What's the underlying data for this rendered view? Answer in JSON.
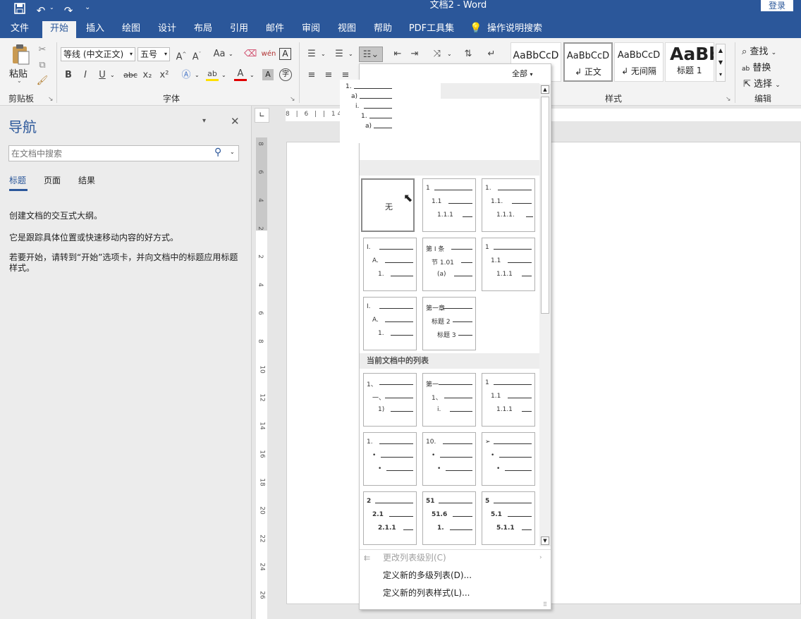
{
  "window": {
    "title": "文档2  -  Word",
    "login": "登录"
  },
  "qat": {
    "save": "save-icon",
    "undo": "undo-icon",
    "redo": "redo-icon"
  },
  "tabs": [
    "文件",
    "开始",
    "插入",
    "绘图",
    "设计",
    "布局",
    "引用",
    "邮件",
    "审阅",
    "视图",
    "帮助",
    "PDF工具集"
  ],
  "search_hint": "操作说明搜索",
  "clipboard": {
    "paste": "粘贴",
    "group": "剪贴板"
  },
  "font": {
    "name": "等线 (中文正文)",
    "size": "五号",
    "group": "字体",
    "case": "Aa",
    "pinyin": "wén",
    "bold": "B",
    "italic": "I",
    "underline": "U",
    "strike": "abc",
    "sub": "x₂",
    "sup": "x²",
    "color_a": "A",
    "shade_a": "A",
    "char_a": "A",
    "enclose": "字"
  },
  "styles": {
    "group": "样式",
    "items": [
      {
        "preview": "AaBbCcD",
        "name": ""
      },
      {
        "preview": "AaBbCcD",
        "name": "↲ 正文"
      },
      {
        "preview": "AaBbCcD",
        "name": "↲ 无间隔"
      },
      {
        "preview": "AaBb",
        "name": "标题 1"
      }
    ]
  },
  "editing": {
    "group": "编辑",
    "find": "查找",
    "replace": "替换",
    "select": "选择"
  },
  "nav": {
    "title": "导航",
    "search_placeholder": "在文档中搜索",
    "tabs": [
      "标题",
      "页面",
      "结果"
    ],
    "p1": "创建文档的交互式大纲。",
    "p2": "它是跟踪具体位置或快速移动内容的好方式。",
    "p3": "若要开始，请转到“开始”选项卡，并向文档中的标题应用标题样式。"
  },
  "ruler": {
    "h": "8 | 6 |        | 14 | 16 | 18 | 20 | 22 | 24 | 26 | 28 | 30",
    "v": [
      "8",
      "6",
      "4",
      "2",
      "2",
      "4",
      "6",
      "8",
      "10",
      "12",
      "14",
      "16",
      "18",
      "20",
      "22",
      "24",
      "26"
    ]
  },
  "gallery": {
    "filter": "全部",
    "preview": [
      "1.",
      "a)",
      "i.",
      "1.",
      "a)"
    ],
    "none_label": "无",
    "current_header": "当前文档中的列表",
    "lib": [
      [
        "1",
        "1.1",
        "1.1.1"
      ],
      [
        "1.",
        "1.1.",
        "1.1.1."
      ],
      [
        "I.",
        "A.",
        "1."
      ],
      [
        "第 Ⅰ 条",
        "节 1.01",
        "(a)"
      ],
      [
        "1",
        "1.1",
        "1.1.1"
      ],
      [
        "I.",
        "A.",
        "1."
      ],
      [
        "第一章",
        "标题 2",
        "标题 3"
      ]
    ],
    "cur": [
      [
        "1、",
        "一、",
        "1)"
      ],
      [
        "第一",
        "1、",
        "i."
      ],
      [
        "1",
        "1.1",
        "1.1.1"
      ],
      [
        "1.",
        "•",
        "•"
      ],
      [
        "10.",
        "•",
        "•"
      ],
      [
        "➢",
        "•",
        "•"
      ],
      [
        "2",
        "2.1",
        "2.1.1"
      ],
      [
        "51",
        "51.6",
        "1."
      ],
      [
        "5",
        "5.1",
        "5.1.1"
      ]
    ],
    "heading_tag": "标题",
    "menu": [
      "更改列表级别(C)",
      "定义新的多级列表(D)...",
      "定义新的列表样式(L)..."
    ]
  }
}
